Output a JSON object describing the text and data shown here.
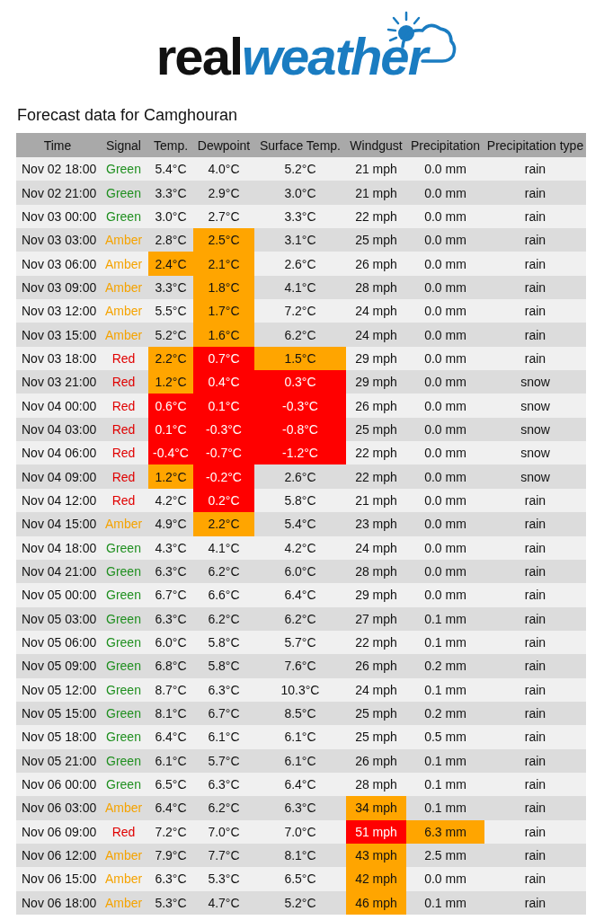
{
  "logo": {
    "part_1": "real",
    "part_2": "weather"
  },
  "title": "Forecast data for Camghouran",
  "table": {
    "columns": [
      "Time",
      "Signal",
      "Temp.",
      "Dewpoint",
      "Surface Temp.",
      "Windgust",
      "Precipitation",
      "Precipitation type"
    ],
    "rows": [
      {
        "time": "Nov 02 18:00",
        "signal": {
          "text": "Green",
          "color": "#1f8f1f"
        },
        "values": [
          {
            "text": "5.4°C",
            "warning": false,
            "severe": false
          },
          {
            "text": "4.0°C",
            "warning": false,
            "severe": false
          },
          {
            "text": "5.2°C",
            "warning": false,
            "severe": false
          },
          {
            "text": "21 mph",
            "warning": false,
            "severe": false
          },
          {
            "text": "0.0 mm",
            "warning": false,
            "severe": false
          }
        ],
        "type": "rain"
      },
      {
        "time": "Nov 02 21:00",
        "signal": {
          "text": "Green",
          "color": "#1f8f1f"
        },
        "values": [
          {
            "text": "3.3°C",
            "warning": false,
            "severe": false
          },
          {
            "text": "2.9°C",
            "warning": false,
            "severe": false
          },
          {
            "text": "3.0°C",
            "warning": false,
            "severe": false
          },
          {
            "text": "21 mph",
            "warning": false,
            "severe": false
          },
          {
            "text": "0.0 mm",
            "warning": false,
            "severe": false
          }
        ],
        "type": "rain"
      },
      {
        "time": "Nov 03 00:00",
        "signal": {
          "text": "Green",
          "color": "#1f8f1f"
        },
        "values": [
          {
            "text": "3.0°C",
            "warning": false,
            "severe": false
          },
          {
            "text": "2.7°C",
            "warning": false,
            "severe": false
          },
          {
            "text": "3.3°C",
            "warning": false,
            "severe": false
          },
          {
            "text": "22 mph",
            "warning": false,
            "severe": false
          },
          {
            "text": "0.0 mm",
            "warning": false,
            "severe": false
          }
        ],
        "type": "rain"
      },
      {
        "time": "Nov 03 03:00",
        "signal": {
          "text": "Amber",
          "color": "#f5a300"
        },
        "values": [
          {
            "text": "2.8°C",
            "warning": false,
            "severe": false
          },
          {
            "text": "2.5°C",
            "warning": true,
            "severe": false
          },
          {
            "text": "3.1°C",
            "warning": false,
            "severe": false
          },
          {
            "text": "25 mph",
            "warning": false,
            "severe": false
          },
          {
            "text": "0.0 mm",
            "warning": false,
            "severe": false
          }
        ],
        "type": "rain"
      },
      {
        "time": "Nov 03 06:00",
        "signal": {
          "text": "Amber",
          "color": "#f5a300"
        },
        "values": [
          {
            "text": "2.4°C",
            "warning": true,
            "severe": false
          },
          {
            "text": "2.1°C",
            "warning": true,
            "severe": false
          },
          {
            "text": "2.6°C",
            "warning": false,
            "severe": false
          },
          {
            "text": "26 mph",
            "warning": false,
            "severe": false
          },
          {
            "text": "0.0 mm",
            "warning": false,
            "severe": false
          }
        ],
        "type": "rain"
      },
      {
        "time": "Nov 03 09:00",
        "signal": {
          "text": "Amber",
          "color": "#f5a300"
        },
        "values": [
          {
            "text": "3.3°C",
            "warning": false,
            "severe": false
          },
          {
            "text": "1.8°C",
            "warning": true,
            "severe": false
          },
          {
            "text": "4.1°C",
            "warning": false,
            "severe": false
          },
          {
            "text": "28 mph",
            "warning": false,
            "severe": false
          },
          {
            "text": "0.0 mm",
            "warning": false,
            "severe": false
          }
        ],
        "type": "rain"
      },
      {
        "time": "Nov 03 12:00",
        "signal": {
          "text": "Amber",
          "color": "#f5a300"
        },
        "values": [
          {
            "text": "5.5°C",
            "warning": false,
            "severe": false
          },
          {
            "text": "1.7°C",
            "warning": true,
            "severe": false
          },
          {
            "text": "7.2°C",
            "warning": false,
            "severe": false
          },
          {
            "text": "24 mph",
            "warning": false,
            "severe": false
          },
          {
            "text": "0.0 mm",
            "warning": false,
            "severe": false
          }
        ],
        "type": "rain"
      },
      {
        "time": "Nov 03 15:00",
        "signal": {
          "text": "Amber",
          "color": "#f5a300"
        },
        "values": [
          {
            "text": "5.2°C",
            "warning": false,
            "severe": false
          },
          {
            "text": "1.6°C",
            "warning": true,
            "severe": false
          },
          {
            "text": "6.2°C",
            "warning": false,
            "severe": false
          },
          {
            "text": "24 mph",
            "warning": false,
            "severe": false
          },
          {
            "text": "0.0 mm",
            "warning": false,
            "severe": false
          }
        ],
        "type": "rain"
      },
      {
        "time": "Nov 03 18:00",
        "signal": {
          "text": "Red",
          "color": "#e00000"
        },
        "values": [
          {
            "text": "2.2°C",
            "warning": true,
            "severe": false
          },
          {
            "text": "0.7°C",
            "warning": false,
            "severe": true
          },
          {
            "text": "1.5°C",
            "warning": true,
            "severe": false
          },
          {
            "text": "29 mph",
            "warning": false,
            "severe": false
          },
          {
            "text": "0.0 mm",
            "warning": false,
            "severe": false
          }
        ],
        "type": "rain"
      },
      {
        "time": "Nov 03 21:00",
        "signal": {
          "text": "Red",
          "color": "#e00000"
        },
        "values": [
          {
            "text": "1.2°C",
            "warning": true,
            "severe": false
          },
          {
            "text": "0.4°C",
            "warning": false,
            "severe": true
          },
          {
            "text": "0.3°C",
            "warning": false,
            "severe": true
          },
          {
            "text": "29 mph",
            "warning": false,
            "severe": false
          },
          {
            "text": "0.0 mm",
            "warning": false,
            "severe": false
          }
        ],
        "type": "snow"
      },
      {
        "time": "Nov 04 00:00",
        "signal": {
          "text": "Red",
          "color": "#e00000"
        },
        "values": [
          {
            "text": "0.6°C",
            "warning": false,
            "severe": true
          },
          {
            "text": "0.1°C",
            "warning": false,
            "severe": true
          },
          {
            "text": "-0.3°C",
            "warning": false,
            "severe": true
          },
          {
            "text": "26 mph",
            "warning": false,
            "severe": false
          },
          {
            "text": "0.0 mm",
            "warning": false,
            "severe": false
          }
        ],
        "type": "snow"
      },
      {
        "time": "Nov 04 03:00",
        "signal": {
          "text": "Red",
          "color": "#e00000"
        },
        "values": [
          {
            "text": "0.1°C",
            "warning": false,
            "severe": true
          },
          {
            "text": "-0.3°C",
            "warning": false,
            "severe": true
          },
          {
            "text": "-0.8°C",
            "warning": false,
            "severe": true
          },
          {
            "text": "25 mph",
            "warning": false,
            "severe": false
          },
          {
            "text": "0.0 mm",
            "warning": false,
            "severe": false
          }
        ],
        "type": "snow"
      },
      {
        "time": "Nov 04 06:00",
        "signal": {
          "text": "Red",
          "color": "#e00000"
        },
        "values": [
          {
            "text": "-0.4°C",
            "warning": false,
            "severe": true
          },
          {
            "text": "-0.7°C",
            "warning": false,
            "severe": true
          },
          {
            "text": "-1.2°C",
            "warning": false,
            "severe": true
          },
          {
            "text": "22 mph",
            "warning": false,
            "severe": false
          },
          {
            "text": "0.0 mm",
            "warning": false,
            "severe": false
          }
        ],
        "type": "snow"
      },
      {
        "time": "Nov 04 09:00",
        "signal": {
          "text": "Red",
          "color": "#e00000"
        },
        "values": [
          {
            "text": "1.2°C",
            "warning": true,
            "severe": false
          },
          {
            "text": "-0.2°C",
            "warning": false,
            "severe": true
          },
          {
            "text": "2.6°C",
            "warning": false,
            "severe": false
          },
          {
            "text": "22 mph",
            "warning": false,
            "severe": false
          },
          {
            "text": "0.0 mm",
            "warning": false,
            "severe": false
          }
        ],
        "type": "snow"
      },
      {
        "time": "Nov 04 12:00",
        "signal": {
          "text": "Red",
          "color": "#e00000"
        },
        "values": [
          {
            "text": "4.2°C",
            "warning": false,
            "severe": false
          },
          {
            "text": "0.2°C",
            "warning": false,
            "severe": true
          },
          {
            "text": "5.8°C",
            "warning": false,
            "severe": false
          },
          {
            "text": "21 mph",
            "warning": false,
            "severe": false
          },
          {
            "text": "0.0 mm",
            "warning": false,
            "severe": false
          }
        ],
        "type": "rain"
      },
      {
        "time": "Nov 04 15:00",
        "signal": {
          "text": "Amber",
          "color": "#f5a300"
        },
        "values": [
          {
            "text": "4.9°C",
            "warning": false,
            "severe": false
          },
          {
            "text": "2.2°C",
            "warning": true,
            "severe": false
          },
          {
            "text": "5.4°C",
            "warning": false,
            "severe": false
          },
          {
            "text": "23 mph",
            "warning": false,
            "severe": false
          },
          {
            "text": "0.0 mm",
            "warning": false,
            "severe": false
          }
        ],
        "type": "rain"
      },
      {
        "time": "Nov 04 18:00",
        "signal": {
          "text": "Green",
          "color": "#1f8f1f"
        },
        "values": [
          {
            "text": "4.3°C",
            "warning": false,
            "severe": false
          },
          {
            "text": "4.1°C",
            "warning": false,
            "severe": false
          },
          {
            "text": "4.2°C",
            "warning": false,
            "severe": false
          },
          {
            "text": "24 mph",
            "warning": false,
            "severe": false
          },
          {
            "text": "0.0 mm",
            "warning": false,
            "severe": false
          }
        ],
        "type": "rain"
      },
      {
        "time": "Nov 04 21:00",
        "signal": {
          "text": "Green",
          "color": "#1f8f1f"
        },
        "values": [
          {
            "text": "6.3°C",
            "warning": false,
            "severe": false
          },
          {
            "text": "6.2°C",
            "warning": false,
            "severe": false
          },
          {
            "text": "6.0°C",
            "warning": false,
            "severe": false
          },
          {
            "text": "28 mph",
            "warning": false,
            "severe": false
          },
          {
            "text": "0.0 mm",
            "warning": false,
            "severe": false
          }
        ],
        "type": "rain"
      },
      {
        "time": "Nov 05 00:00",
        "signal": {
          "text": "Green",
          "color": "#1f8f1f"
        },
        "values": [
          {
            "text": "6.7°C",
            "warning": false,
            "severe": false
          },
          {
            "text": "6.6°C",
            "warning": false,
            "severe": false
          },
          {
            "text": "6.4°C",
            "warning": false,
            "severe": false
          },
          {
            "text": "29 mph",
            "warning": false,
            "severe": false
          },
          {
            "text": "0.0 mm",
            "warning": false,
            "severe": false
          }
        ],
        "type": "rain"
      },
      {
        "time": "Nov 05 03:00",
        "signal": {
          "text": "Green",
          "color": "#1f8f1f"
        },
        "values": [
          {
            "text": "6.3°C",
            "warning": false,
            "severe": false
          },
          {
            "text": "6.2°C",
            "warning": false,
            "severe": false
          },
          {
            "text": "6.2°C",
            "warning": false,
            "severe": false
          },
          {
            "text": "27 mph",
            "warning": false,
            "severe": false
          },
          {
            "text": "0.1 mm",
            "warning": false,
            "severe": false
          }
        ],
        "type": "rain"
      },
      {
        "time": "Nov 05 06:00",
        "signal": {
          "text": "Green",
          "color": "#1f8f1f"
        },
        "values": [
          {
            "text": "6.0°C",
            "warning": false,
            "severe": false
          },
          {
            "text": "5.8°C",
            "warning": false,
            "severe": false
          },
          {
            "text": "5.7°C",
            "warning": false,
            "severe": false
          },
          {
            "text": "22 mph",
            "warning": false,
            "severe": false
          },
          {
            "text": "0.1 mm",
            "warning": false,
            "severe": false
          }
        ],
        "type": "rain"
      },
      {
        "time": "Nov 05 09:00",
        "signal": {
          "text": "Green",
          "color": "#1f8f1f"
        },
        "values": [
          {
            "text": "6.8°C",
            "warning": false,
            "severe": false
          },
          {
            "text": "5.8°C",
            "warning": false,
            "severe": false
          },
          {
            "text": "7.6°C",
            "warning": false,
            "severe": false
          },
          {
            "text": "26 mph",
            "warning": false,
            "severe": false
          },
          {
            "text": "0.2 mm",
            "warning": false,
            "severe": false
          }
        ],
        "type": "rain"
      },
      {
        "time": "Nov 05 12:00",
        "signal": {
          "text": "Green",
          "color": "#1f8f1f"
        },
        "values": [
          {
            "text": "8.7°C",
            "warning": false,
            "severe": false
          },
          {
            "text": "6.3°C",
            "warning": false,
            "severe": false
          },
          {
            "text": "10.3°C",
            "warning": false,
            "severe": false
          },
          {
            "text": "24 mph",
            "warning": false,
            "severe": false
          },
          {
            "text": "0.1 mm",
            "warning": false,
            "severe": false
          }
        ],
        "type": "rain"
      },
      {
        "time": "Nov 05 15:00",
        "signal": {
          "text": "Green",
          "color": "#1f8f1f"
        },
        "values": [
          {
            "text": "8.1°C",
            "warning": false,
            "severe": false
          },
          {
            "text": "6.7°C",
            "warning": false,
            "severe": false
          },
          {
            "text": "8.5°C",
            "warning": false,
            "severe": false
          },
          {
            "text": "25 mph",
            "warning": false,
            "severe": false
          },
          {
            "text": "0.2 mm",
            "warning": false,
            "severe": false
          }
        ],
        "type": "rain"
      },
      {
        "time": "Nov 05 18:00",
        "signal": {
          "text": "Green",
          "color": "#1f8f1f"
        },
        "values": [
          {
            "text": "6.4°C",
            "warning": false,
            "severe": false
          },
          {
            "text": "6.1°C",
            "warning": false,
            "severe": false
          },
          {
            "text": "6.1°C",
            "warning": false,
            "severe": false
          },
          {
            "text": "25 mph",
            "warning": false,
            "severe": false
          },
          {
            "text": "0.5 mm",
            "warning": false,
            "severe": false
          }
        ],
        "type": "rain"
      },
      {
        "time": "Nov 05 21:00",
        "signal": {
          "text": "Green",
          "color": "#1f8f1f"
        },
        "values": [
          {
            "text": "6.1°C",
            "warning": false,
            "severe": false
          },
          {
            "text": "5.7°C",
            "warning": false,
            "severe": false
          },
          {
            "text": "6.1°C",
            "warning": false,
            "severe": false
          },
          {
            "text": "26 mph",
            "warning": false,
            "severe": false
          },
          {
            "text": "0.1 mm",
            "warning": false,
            "severe": false
          }
        ],
        "type": "rain"
      },
      {
        "time": "Nov 06 00:00",
        "signal": {
          "text": "Green",
          "color": "#1f8f1f"
        },
        "values": [
          {
            "text": "6.5°C",
            "warning": false,
            "severe": false
          },
          {
            "text": "6.3°C",
            "warning": false,
            "severe": false
          },
          {
            "text": "6.4°C",
            "warning": false,
            "severe": false
          },
          {
            "text": "28 mph",
            "warning": false,
            "severe": false
          },
          {
            "text": "0.1 mm",
            "warning": false,
            "severe": false
          }
        ],
        "type": "rain"
      },
      {
        "time": "Nov 06 03:00",
        "signal": {
          "text": "Amber",
          "color": "#f5a300"
        },
        "values": [
          {
            "text": "6.4°C",
            "warning": false,
            "severe": false
          },
          {
            "text": "6.2°C",
            "warning": false,
            "severe": false
          },
          {
            "text": "6.3°C",
            "warning": false,
            "severe": false
          },
          {
            "text": "34 mph",
            "warning": true,
            "severe": false
          },
          {
            "text": "0.1 mm",
            "warning": false,
            "severe": false
          }
        ],
        "type": "rain"
      },
      {
        "time": "Nov 06 09:00",
        "signal": {
          "text": "Red",
          "color": "#e00000"
        },
        "values": [
          {
            "text": "7.2°C",
            "warning": false,
            "severe": false
          },
          {
            "text": "7.0°C",
            "warning": false,
            "severe": false
          },
          {
            "text": "7.0°C",
            "warning": false,
            "severe": false
          },
          {
            "text": "51 mph",
            "warning": false,
            "severe": true
          },
          {
            "text": "6.3 mm",
            "warning": true,
            "severe": false
          }
        ],
        "type": "rain"
      },
      {
        "time": "Nov 06 12:00",
        "signal": {
          "text": "Amber",
          "color": "#f5a300"
        },
        "values": [
          {
            "text": "7.9°C",
            "warning": false,
            "severe": false
          },
          {
            "text": "7.7°C",
            "warning": false,
            "severe": false
          },
          {
            "text": "8.1°C",
            "warning": false,
            "severe": false
          },
          {
            "text": "43 mph",
            "warning": true,
            "severe": false
          },
          {
            "text": "2.5 mm",
            "warning": false,
            "severe": false
          }
        ],
        "type": "rain"
      },
      {
        "time": "Nov 06 15:00",
        "signal": {
          "text": "Amber",
          "color": "#f5a300"
        },
        "values": [
          {
            "text": "6.3°C",
            "warning": false,
            "severe": false
          },
          {
            "text": "5.3°C",
            "warning": false,
            "severe": false
          },
          {
            "text": "6.5°C",
            "warning": false,
            "severe": false
          },
          {
            "text": "42 mph",
            "warning": true,
            "severe": false
          },
          {
            "text": "0.0 mm",
            "warning": false,
            "severe": false
          }
        ],
        "type": "rain"
      },
      {
        "time": "Nov 06 18:00",
        "signal": {
          "text": "Amber",
          "color": "#f5a300"
        },
        "values": [
          {
            "text": "5.3°C",
            "warning": false,
            "severe": false
          },
          {
            "text": "4.7°C",
            "warning": false,
            "severe": false
          },
          {
            "text": "5.2°C",
            "warning": false,
            "severe": false
          },
          {
            "text": "46 mph",
            "warning": true,
            "severe": false
          },
          {
            "text": "0.1 mm",
            "warning": false,
            "severe": false
          }
        ],
        "type": "rain"
      }
    ]
  }
}
